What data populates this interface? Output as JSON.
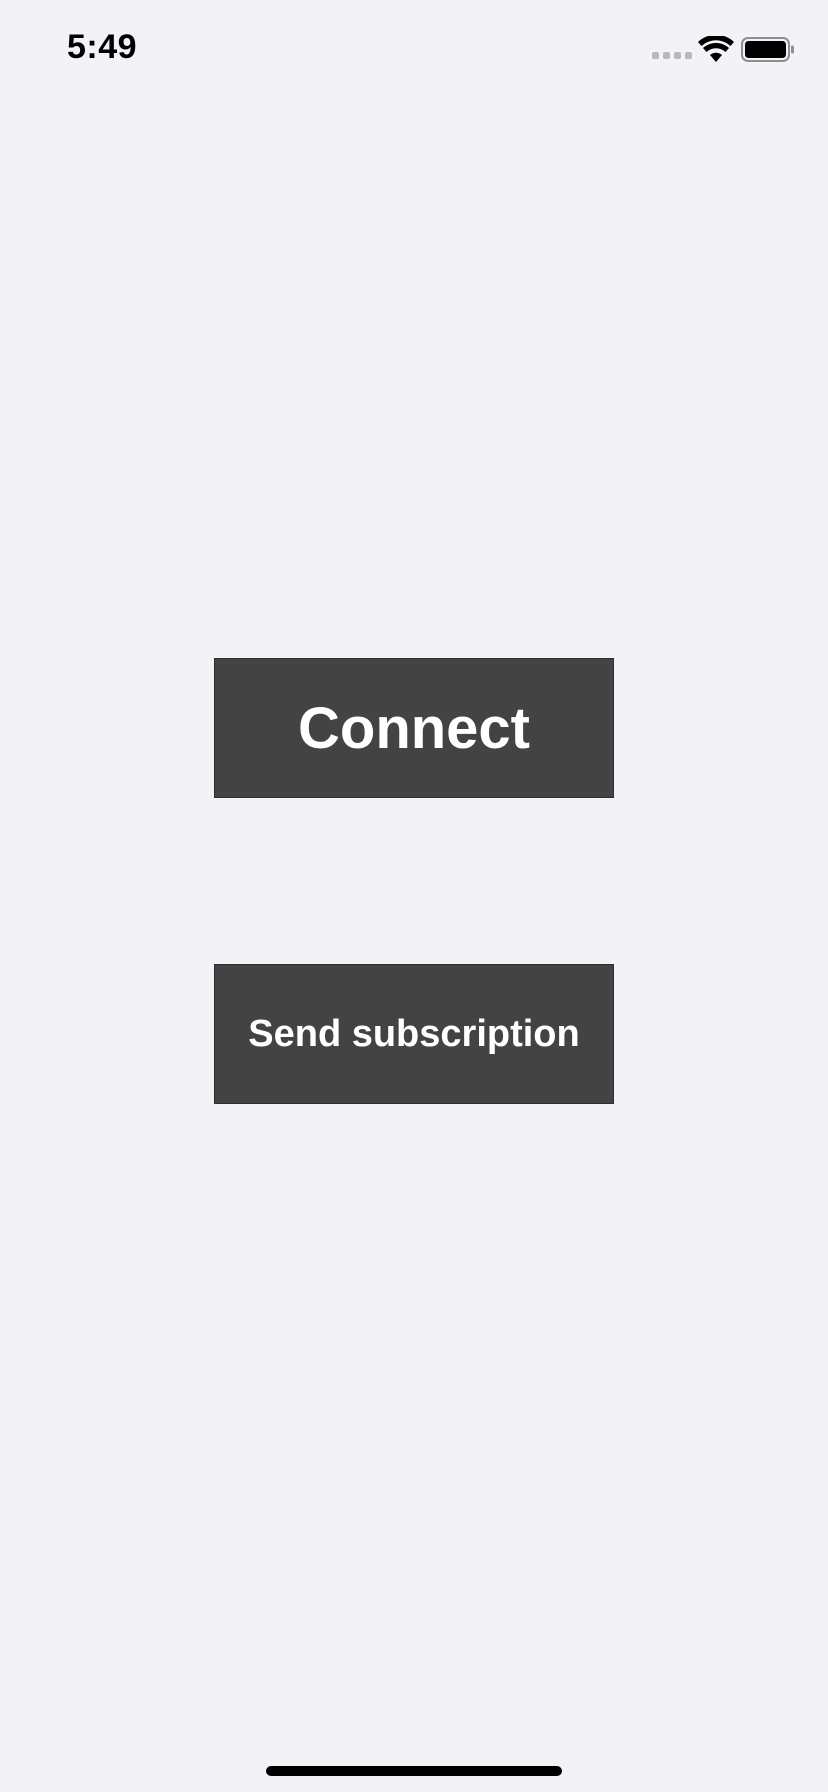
{
  "status_bar": {
    "time": "5:49",
    "signal_icon": "cellular-signal-icon",
    "wifi_icon": "wifi-icon",
    "battery_icon": "battery-icon"
  },
  "main": {
    "connect_label": "Connect",
    "subscribe_label": "Send subscription"
  },
  "colors": {
    "background": "#f2f2f7",
    "button_bg": "#434343",
    "button_text": "#ffffff"
  }
}
